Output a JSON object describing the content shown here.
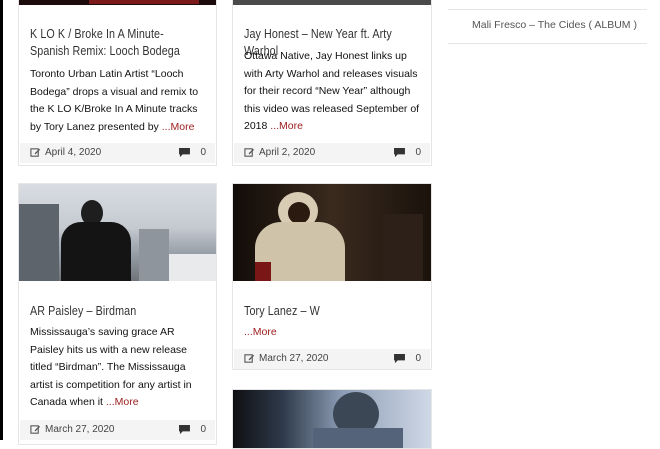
{
  "posts": [
    {
      "title": "K LO K / Broke In A Minute- Spanish Remix: Looch Bodega",
      "excerpt": "Toronto Urban Latin Artist “Looch Bodega” drops a visual and remix to the K LO K/Broke In A Minute tracks by Tory Lanez presented by",
      "more": "...More",
      "date": "April 4, 2020",
      "comments": "0"
    },
    {
      "title": "Jay Honest – New Year ft. Arty Warhol",
      "excerpt": "Ottawa Native, Jay Honest links up with Arty Warhol and releases visuals for their record “New Year” although this video was released September of 2018",
      "more": "...More",
      "date": "April 2, 2020",
      "comments": "0"
    },
    {
      "title": "AR Paisley – Birdman",
      "excerpt": "Mississauga’s saving grace AR Paisley hits us with a new release titled “Birdman”. The Mississauga artist is competition for any artist in Canada when it",
      "more": "...More",
      "date": "March 27, 2020",
      "comments": "0"
    },
    {
      "title": "Tory Lanez – W",
      "excerpt": "",
      "more": "...More",
      "date": "March 27, 2020",
      "comments": "0"
    }
  ],
  "sidebar": {
    "album_link": "Mali Fresco – The Cides ( ALBUM )"
  },
  "icons": {
    "date": "edit-calendar-icon",
    "comments": "speech-bubble-icon"
  },
  "colors": {
    "more_link": "#9b1c1c",
    "meta_bar": "#f4f4f4"
  }
}
